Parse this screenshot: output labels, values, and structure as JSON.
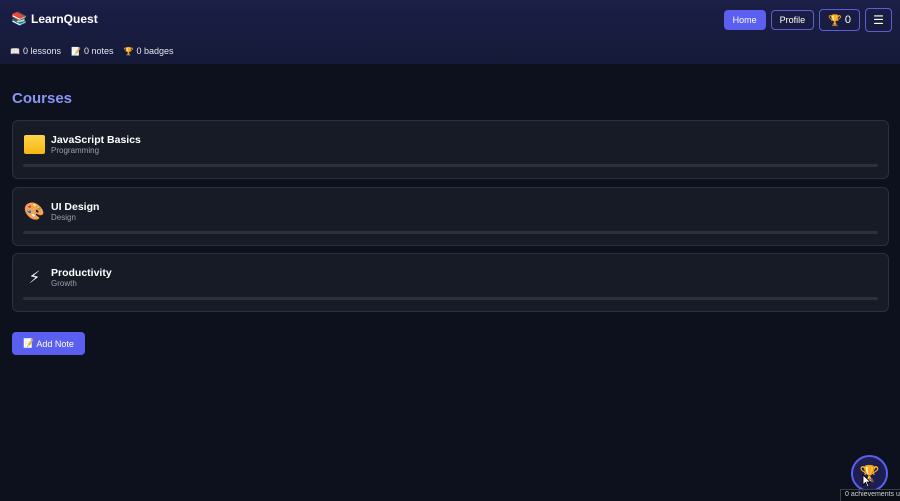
{
  "app": {
    "name": "LearnQuest",
    "logo_icon": "📚"
  },
  "nav": {
    "home_label": "Home",
    "profile_label": "Profile",
    "trophy_icon": "🏆",
    "trophy_count": "0",
    "menu_icon": "☰"
  },
  "stats": [
    {
      "icon": "📖",
      "text": "0 lessons"
    },
    {
      "icon": "📝",
      "text": "0 notes"
    },
    {
      "icon": "🏆",
      "text": "0 badges"
    }
  ],
  "courses_title": "Courses",
  "courses": [
    {
      "name": "JavaScript Basics",
      "category": "Programming",
      "icon": "yellow-square",
      "progress": 0
    },
    {
      "name": "UI Design",
      "category": "Design",
      "icon": "🎨",
      "progress": 0
    },
    {
      "name": "Productivity",
      "category": "Growth",
      "icon": "⚡",
      "progress": 0
    }
  ],
  "add_note": {
    "icon": "📝",
    "label": "Add Note"
  },
  "fab": {
    "icon": "🏆"
  },
  "toast": {
    "text": "0 achievements u"
  },
  "colors": {
    "accent": "#5b5ff0",
    "title": "#8b93f4",
    "background": "#0c111d",
    "card": "#161b26"
  }
}
